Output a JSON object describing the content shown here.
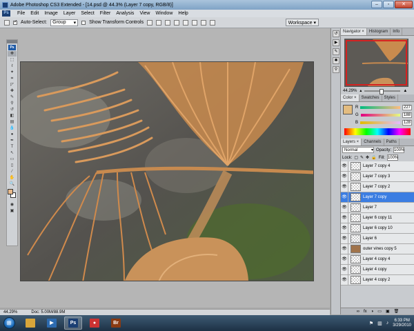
{
  "titlebar": {
    "title": "Adobe Photoshop CS3 Extended - [14.psd @ 44.3% (Layer 7 copy, RGB/8)]"
  },
  "window_buttons": {
    "minimize": "–",
    "restore": "▫",
    "close": "✕"
  },
  "menubar": {
    "logo": "Ps",
    "items": [
      "File",
      "Edit",
      "Image",
      "Layer",
      "Select",
      "Filter",
      "Analysis",
      "View",
      "Window",
      "Help"
    ]
  },
  "options": {
    "auto_select_label": "Auto-Select:",
    "auto_select_value": "Group",
    "transform_label": "Show Transform Controls",
    "workspace_label": "Workspace ▾"
  },
  "toolbox": {
    "logo": "Ps"
  },
  "status": {
    "zoom": "44.29%",
    "doc": "Doc: 5.00M/88.9M"
  },
  "navigator": {
    "tabs": [
      "Navigator ×",
      "Histogram",
      "Info"
    ],
    "zoom": "44.29%"
  },
  "color_panel": {
    "tabs": [
      "Color ×",
      "Swatches",
      "Styles"
    ],
    "rows": [
      {
        "label": "R",
        "value": "227"
      },
      {
        "label": "G",
        "value": "188"
      },
      {
        "label": "B",
        "value": "128"
      }
    ],
    "foreground": "#e3bc80"
  },
  "layers_panel": {
    "tabs": [
      "Layers ×",
      "Channels",
      "Paths"
    ],
    "blend_mode": "Normal",
    "opacity_label": "Opacity:",
    "opacity": "100%",
    "lock_label": "Lock:",
    "fill_label": "Fill:",
    "fill": "100%",
    "layers": [
      {
        "name": "Layer 7 copy 4",
        "selected": false,
        "image": false
      },
      {
        "name": "Layer 7 copy 3",
        "selected": false,
        "image": false
      },
      {
        "name": "Layer 7 copy 2",
        "selected": false,
        "image": false
      },
      {
        "name": "Layer 7 copy",
        "selected": true,
        "image": false
      },
      {
        "name": "Layer 7",
        "selected": false,
        "image": false
      },
      {
        "name": "Layer 6 copy 11",
        "selected": false,
        "image": false
      },
      {
        "name": "Layer 6 copy 10",
        "selected": false,
        "image": false
      },
      {
        "name": "Layer 6",
        "selected": false,
        "image": false
      },
      {
        "name": "outer vines copy 5",
        "selected": false,
        "image": true
      },
      {
        "name": "Layer 4 copy 4",
        "selected": false,
        "image": false
      },
      {
        "name": "Layer 4 copy",
        "selected": false,
        "image": false
      },
      {
        "name": "Layer 4 copy 2",
        "selected": false,
        "image": false
      }
    ],
    "footer_icons": [
      "fx",
      "◑",
      "▭",
      "▣",
      "🗑"
    ]
  },
  "taskbar": {
    "start": "⊞",
    "apps": [
      {
        "name": "explorer-icon",
        "label": "",
        "color": "#d8a53a"
      },
      {
        "name": "media-player-icon",
        "label": "▶",
        "color": "#2d6bb0"
      },
      {
        "name": "photoshop-icon",
        "label": "Ps",
        "color": "#1b3f73"
      },
      {
        "name": "chrome-icon",
        "label": "●",
        "color": "#c33"
      },
      {
        "name": "bridge-icon",
        "label": "Br",
        "color": "#8a3a12"
      }
    ],
    "time": "6:33 PM",
    "date": "3/29/2010"
  }
}
